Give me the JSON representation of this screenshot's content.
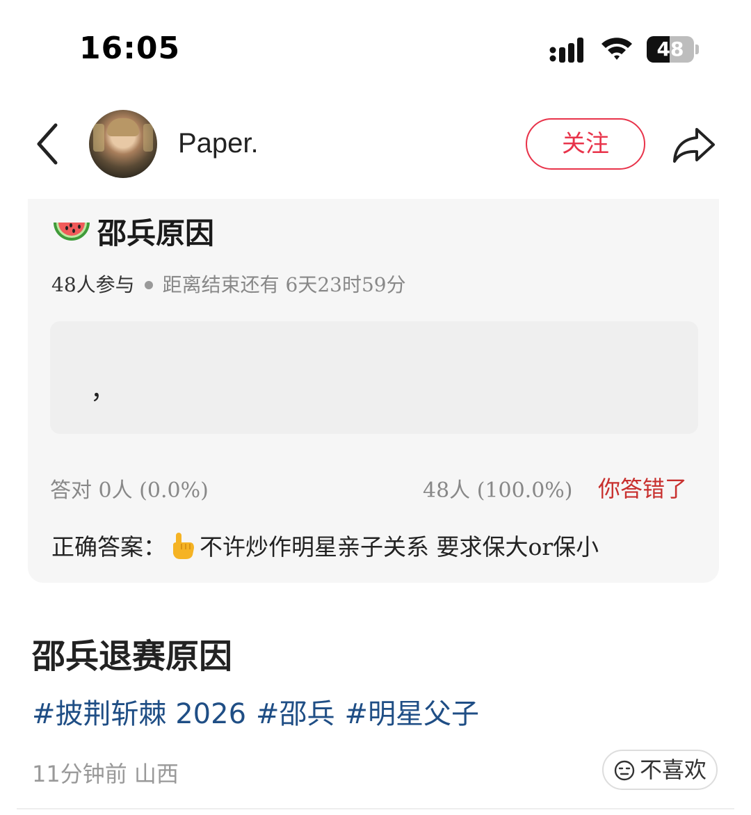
{
  "status_bar": {
    "time": "16:05",
    "battery": "48",
    "battery_level": 0.48
  },
  "header": {
    "username": "Paper.",
    "follow_label": "关注"
  },
  "quiz": {
    "title": "邵兵原因",
    "participants": "48人参与",
    "time_left": "距离结束还有 6天23时59分",
    "answer_text": "，",
    "correct_count": "答对  0人 (0.0%)",
    "wrong_count": "48人 (100.0%)",
    "result": "你答错了",
    "correct_label": "正确答案：",
    "correct_answer": "不许炒作明星亲子关系 要求保大or保小"
  },
  "post": {
    "title": "邵兵退赛原因",
    "tags": [
      "#披荆斩棘 2026",
      "#邵兵",
      "#明星父子"
    ],
    "meta": "11分钟前 山西",
    "dislike_label": "不喜欢"
  },
  "colors": {
    "accent": "#e8334a",
    "tag": "#1f4e85",
    "wrong": "#c8302e"
  }
}
